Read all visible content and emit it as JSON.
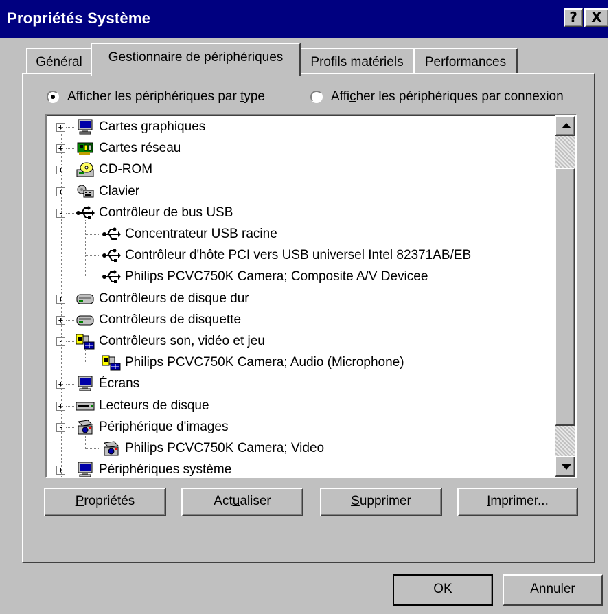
{
  "window": {
    "title": "Propriétés Système",
    "help_glyph": "?",
    "close_glyph": "X"
  },
  "tabs": [
    {
      "label": "Général"
    },
    {
      "label": "Gestionnaire de périphériques"
    },
    {
      "label": "Profils matériels"
    },
    {
      "label": "Performances"
    }
  ],
  "view_options": {
    "by_type": {
      "pre": "Afficher les périphériques par ",
      "ul": "t",
      "post": "ype",
      "selected": true
    },
    "by_connection": {
      "pre": "Affi",
      "ul": "c",
      "post": "her les périphériques par connexion",
      "selected": false
    }
  },
  "device_tree": [
    {
      "label": "Cartes graphiques",
      "icon": "monitor-icon",
      "level": 0,
      "expander": "+"
    },
    {
      "label": "Cartes réseau",
      "icon": "network-card-icon",
      "level": 0,
      "expander": "+"
    },
    {
      "label": "CD-ROM",
      "icon": "cdrom-icon",
      "level": 0,
      "expander": "+"
    },
    {
      "label": "Clavier",
      "icon": "keyboard-icon",
      "level": 0,
      "expander": "+"
    },
    {
      "label": "Contrôleur de bus USB",
      "icon": "usb-icon",
      "level": 0,
      "expander": "-"
    },
    {
      "label": "Concentrateur USB racine",
      "icon": "usb-icon",
      "level": 1
    },
    {
      "label": "Contrôleur d'hôte PCI vers USB universel Intel 82371AB/EB",
      "icon": "usb-icon",
      "level": 1
    },
    {
      "label": "Philips PCVC750K Camera; Composite A/V Devicee",
      "icon": "usb-icon",
      "level": 1
    },
    {
      "label": "Contrôleurs de disque dur",
      "icon": "disk-controller-icon",
      "level": 0,
      "expander": "+"
    },
    {
      "label": "Contrôleurs de disquette",
      "icon": "disk-controller-icon",
      "level": 0,
      "expander": "+"
    },
    {
      "label": "Contrôleurs son, vidéo et jeu",
      "icon": "sound-video-game-icon",
      "level": 0,
      "expander": "-"
    },
    {
      "label": "Philips PCVC750K Camera; Audio (Microphone)",
      "icon": "sound-video-game-icon",
      "level": 1
    },
    {
      "label": "Écrans",
      "icon": "monitor-icon",
      "level": 0,
      "expander": "+"
    },
    {
      "label": "Lecteurs de disque",
      "icon": "disk-drive-icon",
      "level": 0,
      "expander": "+"
    },
    {
      "label": "Périphérique d'images",
      "icon": "imaging-device-icon",
      "level": 0,
      "expander": "-"
    },
    {
      "label": "Philips PCVC750K Camera; Video",
      "icon": "imaging-device-icon",
      "level": 1
    },
    {
      "label": "Périphériques système",
      "icon": "monitor-icon",
      "level": 0,
      "expander": "+"
    }
  ],
  "actions": {
    "properties": {
      "ul": "P",
      "rest": "ropriétés"
    },
    "refresh": {
      "pre": "Act",
      "ul": "u",
      "post": "aliser"
    },
    "remove": {
      "ul": "S",
      "rest": "upprimer"
    },
    "print": {
      "ul": "I",
      "rest": "mprimer..."
    }
  },
  "footer": {
    "ok_label": "OK",
    "cancel_label": "Annuler"
  },
  "colors": {
    "title_bar": "#000080",
    "face": "#c0c0c0",
    "accent_green": "#008000",
    "monitor_blue": "#0000a8"
  }
}
